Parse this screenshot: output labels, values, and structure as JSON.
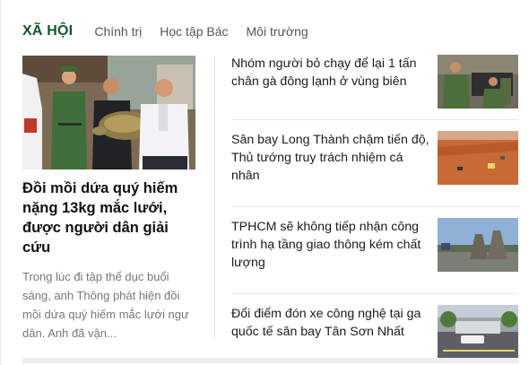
{
  "section": {
    "title": "XÃ HỘI",
    "tabs": [
      "Chính trị",
      "Học tập Bác",
      "Môi trường"
    ]
  },
  "featured": {
    "title": "Đồi mồi dứa quý hiếm nặng 13kg mắc lưới, được người dân giải cứu",
    "description": "Trong lúc đi tập thể dục buổi sáng, anh Thông phát hiện đồi mồi dứa quý hiếm mắc lưới ngư dân. Anh đã vận..."
  },
  "articles": [
    {
      "title": "Nhóm người bỏ chạy để lại 1 tấn chân gà đông lạnh ở vùng biên"
    },
    {
      "title": "Sân bay Long Thành chậm tiến độ, Thủ tướng truy trách nhiệm cá nhân"
    },
    {
      "title": "TPHCM sẽ không tiếp nhận công trình hạ tầng giao thông kém chất lượng"
    },
    {
      "title": "Đổi điểm đón xe công nghệ tại ga quốc tế sân bay Tân Sơn Nhất"
    }
  ],
  "colors": {
    "brand_green": "#12552b",
    "tab_text": "#555555",
    "excerpt_text": "#777777",
    "divider": "#e6e6e6"
  }
}
